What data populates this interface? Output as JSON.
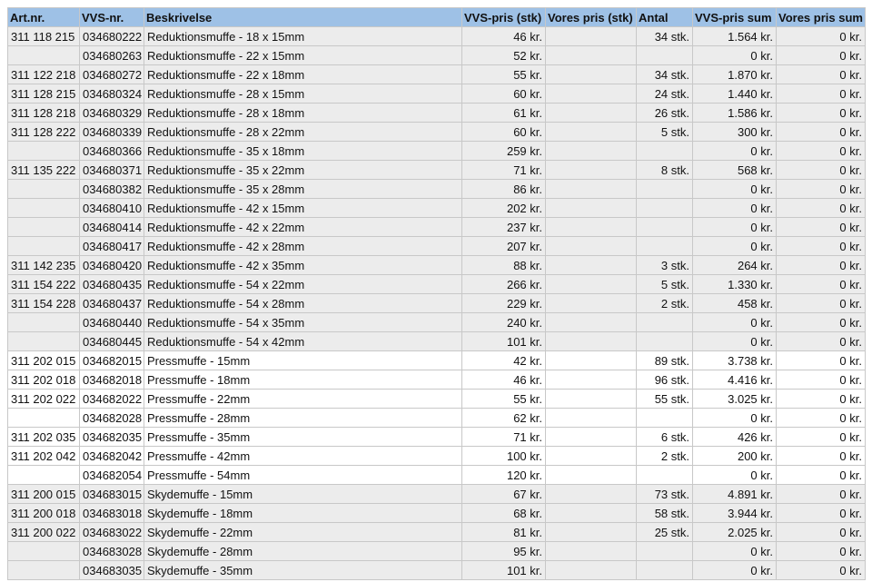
{
  "table": {
    "headers": [
      "Art.nr.",
      "VVS-nr.",
      "Beskrivelse",
      "VVS-pris (stk)",
      "Vores pris (stk)",
      "Antal",
      "VVS-pris sum",
      "Vores pris sum"
    ],
    "rows": [
      {
        "art": "311 118 215",
        "vvs": "034680222",
        "desc": "Reduktionsmuffe - 18 x 15mm",
        "vvs_price": "46 kr.",
        "our_price": "",
        "qty": "34 stk.",
        "vvs_sum": "1.564 kr.",
        "our_sum": "0 kr.",
        "bg": "g"
      },
      {
        "art": "",
        "vvs": "034680263",
        "desc": "Reduktionsmuffe - 22 x 15mm",
        "vvs_price": "52 kr.",
        "our_price": "",
        "qty": "",
        "vvs_sum": "0 kr.",
        "our_sum": "0 kr.",
        "bg": "g"
      },
      {
        "art": "311 122 218",
        "vvs": "034680272",
        "desc": "Reduktionsmuffe - 22 x 18mm",
        "vvs_price": "55 kr.",
        "our_price": "",
        "qty": "34 stk.",
        "vvs_sum": "1.870 kr.",
        "our_sum": "0 kr.",
        "bg": "g"
      },
      {
        "art": "311 128 215",
        "vvs": "034680324",
        "desc": "Reduktionsmuffe - 28 x 15mm",
        "vvs_price": "60 kr.",
        "our_price": "",
        "qty": "24 stk.",
        "vvs_sum": "1.440 kr.",
        "our_sum": "0 kr.",
        "bg": "g"
      },
      {
        "art": "311 128 218",
        "vvs": "034680329",
        "desc": "Reduktionsmuffe - 28 x 18mm",
        "vvs_price": "61 kr.",
        "our_price": "",
        "qty": "26 stk.",
        "vvs_sum": "1.586 kr.",
        "our_sum": "0 kr.",
        "bg": "g"
      },
      {
        "art": "311 128 222",
        "vvs": "034680339",
        "desc": "Reduktionsmuffe - 28 x 22mm",
        "vvs_price": "60 kr.",
        "our_price": "",
        "qty": "5 stk.",
        "vvs_sum": "300 kr.",
        "our_sum": "0 kr.",
        "bg": "g"
      },
      {
        "art": "",
        "vvs": "034680366",
        "desc": "Reduktionsmuffe - 35 x 18mm",
        "vvs_price": "259 kr.",
        "our_price": "",
        "qty": "",
        "vvs_sum": "0 kr.",
        "our_sum": "0 kr.",
        "bg": "g"
      },
      {
        "art": "311 135 222",
        "vvs": "034680371",
        "desc": "Reduktionsmuffe - 35 x 22mm",
        "vvs_price": "71 kr.",
        "our_price": "",
        "qty": "8 stk.",
        "vvs_sum": "568 kr.",
        "our_sum": "0 kr.",
        "bg": "g"
      },
      {
        "art": "",
        "vvs": "034680382",
        "desc": "Reduktionsmuffe - 35 x 28mm",
        "vvs_price": "86 kr.",
        "our_price": "",
        "qty": "",
        "vvs_sum": "0 kr.",
        "our_sum": "0 kr.",
        "bg": "g"
      },
      {
        "art": "",
        "vvs": "034680410",
        "desc": "Reduktionsmuffe - 42 x 15mm",
        "vvs_price": "202 kr.",
        "our_price": "",
        "qty": "",
        "vvs_sum": "0 kr.",
        "our_sum": "0 kr.",
        "bg": "g"
      },
      {
        "art": "",
        "vvs": "034680414",
        "desc": "Reduktionsmuffe - 42 x 22mm",
        "vvs_price": "237 kr.",
        "our_price": "",
        "qty": "",
        "vvs_sum": "0 kr.",
        "our_sum": "0 kr.",
        "bg": "g"
      },
      {
        "art": "",
        "vvs": "034680417",
        "desc": "Reduktionsmuffe - 42 x 28mm",
        "vvs_price": "207 kr.",
        "our_price": "",
        "qty": "",
        "vvs_sum": "0 kr.",
        "our_sum": "0 kr.",
        "bg": "g"
      },
      {
        "art": "311 142 235",
        "vvs": "034680420",
        "desc": "Reduktionsmuffe - 42 x 35mm",
        "vvs_price": "88 kr.",
        "our_price": "",
        "qty": "3 stk.",
        "vvs_sum": "264 kr.",
        "our_sum": "0 kr.",
        "bg": "g"
      },
      {
        "art": "311 154 222",
        "vvs": "034680435",
        "desc": "Reduktionsmuffe - 54 x 22mm",
        "vvs_price": "266 kr.",
        "our_price": "",
        "qty": "5 stk.",
        "vvs_sum": "1.330 kr.",
        "our_sum": "0 kr.",
        "bg": "g"
      },
      {
        "art": "311 154 228",
        "vvs": "034680437",
        "desc": "Reduktionsmuffe - 54 x 28mm",
        "vvs_price": "229 kr.",
        "our_price": "",
        "qty": "2 stk.",
        "vvs_sum": "458 kr.",
        "our_sum": "0 kr.",
        "bg": "g"
      },
      {
        "art": "",
        "vvs": "034680440",
        "desc": "Reduktionsmuffe - 54 x 35mm",
        "vvs_price": "240 kr.",
        "our_price": "",
        "qty": "",
        "vvs_sum": "0 kr.",
        "our_sum": "0 kr.",
        "bg": "g"
      },
      {
        "art": "",
        "vvs": "034680445",
        "desc": "Reduktionsmuffe - 54 x 42mm",
        "vvs_price": "101 kr.",
        "our_price": "",
        "qty": "",
        "vvs_sum": "0 kr.",
        "our_sum": "0 kr.",
        "bg": "g"
      },
      {
        "art": "311 202 015",
        "vvs": "034682015",
        "desc": "Pressmuffe - 15mm",
        "vvs_price": "42 kr.",
        "our_price": "",
        "qty": "89 stk.",
        "vvs_sum": "3.738 kr.",
        "our_sum": "0 kr.",
        "bg": "w"
      },
      {
        "art": "311 202 018",
        "vvs": "034682018",
        "desc": "Pressmuffe - 18mm",
        "vvs_price": "46 kr.",
        "our_price": "",
        "qty": "96 stk.",
        "vvs_sum": "4.416 kr.",
        "our_sum": "0 kr.",
        "bg": "w"
      },
      {
        "art": "311 202 022",
        "vvs": "034682022",
        "desc": "Pressmuffe - 22mm",
        "vvs_price": "55 kr.",
        "our_price": "",
        "qty": "55 stk.",
        "vvs_sum": "3.025 kr.",
        "our_sum": "0 kr.",
        "bg": "w"
      },
      {
        "art": "",
        "vvs": "034682028",
        "desc": "Pressmuffe - 28mm",
        "vvs_price": "62 kr.",
        "our_price": "",
        "qty": "",
        "vvs_sum": "0 kr.",
        "our_sum": "0 kr.",
        "bg": "w"
      },
      {
        "art": "311 202 035",
        "vvs": "034682035",
        "desc": "Pressmuffe - 35mm",
        "vvs_price": "71 kr.",
        "our_price": "",
        "qty": "6 stk.",
        "vvs_sum": "426 kr.",
        "our_sum": "0 kr.",
        "bg": "w"
      },
      {
        "art": "311 202 042",
        "vvs": "034682042",
        "desc": "Pressmuffe - 42mm",
        "vvs_price": "100 kr.",
        "our_price": "",
        "qty": "2 stk.",
        "vvs_sum": "200 kr.",
        "our_sum": "0 kr.",
        "bg": "w"
      },
      {
        "art": "",
        "vvs": "034682054",
        "desc": "Pressmuffe - 54mm",
        "vvs_price": "120 kr.",
        "our_price": "",
        "qty": "",
        "vvs_sum": "0 kr.",
        "our_sum": "0 kr.",
        "bg": "w"
      },
      {
        "art": "311 200 015",
        "vvs": "034683015",
        "desc": "Skydemuffe - 15mm",
        "vvs_price": "67 kr.",
        "our_price": "",
        "qty": "73 stk.",
        "vvs_sum": "4.891 kr.",
        "our_sum": "0 kr.",
        "bg": "g"
      },
      {
        "art": "311 200 018",
        "vvs": "034683018",
        "desc": "Skydemuffe - 18mm",
        "vvs_price": "68 kr.",
        "our_price": "",
        "qty": "58 stk.",
        "vvs_sum": "3.944 kr.",
        "our_sum": "0 kr.",
        "bg": "g"
      },
      {
        "art": "311 200 022",
        "vvs": "034683022",
        "desc": "Skydemuffe - 22mm",
        "vvs_price": "81 kr.",
        "our_price": "",
        "qty": "25 stk.",
        "vvs_sum": "2.025 kr.",
        "our_sum": "0 kr.",
        "bg": "g"
      },
      {
        "art": "",
        "vvs": "034683028",
        "desc": "Skydemuffe - 28mm",
        "vvs_price": "95 kr.",
        "our_price": "",
        "qty": "",
        "vvs_sum": "0 kr.",
        "our_sum": "0 kr.",
        "bg": "g"
      },
      {
        "art": "",
        "vvs": "034683035",
        "desc": "Skydemuffe - 35mm",
        "vvs_price": "101 kr.",
        "our_price": "",
        "qty": "",
        "vvs_sum": "0 kr.",
        "our_sum": "0 kr.",
        "bg": "g"
      }
    ]
  },
  "colors": {
    "header_bg": "#9ec1e6",
    "row_gray": "#ececec",
    "row_white": "#ffffff",
    "border": "#c8c8c8"
  }
}
